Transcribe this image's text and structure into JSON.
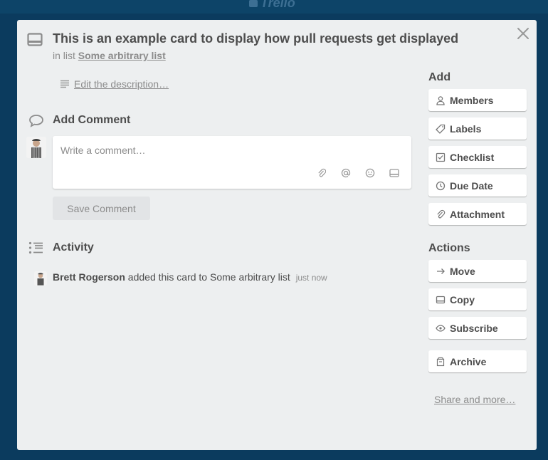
{
  "app": {
    "logo_text": "Trello"
  },
  "card": {
    "title": "This is an example card to display how pull requests get displayed",
    "in_list_prefix": "in list",
    "list_name": "Some arbitrary list",
    "edit_description": "Edit the description…"
  },
  "comment": {
    "heading": "Add Comment",
    "placeholder": "Write a comment…",
    "save_label": "Save Comment",
    "tool_icons": [
      "attachment-icon",
      "mention-icon",
      "emoji-icon",
      "card-icon"
    ]
  },
  "activity": {
    "heading": "Activity",
    "entries": [
      {
        "user": "Brett Rogerson",
        "action": "added this card to Some arbitrary list",
        "time": "just now"
      }
    ]
  },
  "sidebar": {
    "add_heading": "Add",
    "add_buttons": [
      {
        "label": "Members",
        "icon": "person-icon"
      },
      {
        "label": "Labels",
        "icon": "tag-icon"
      },
      {
        "label": "Checklist",
        "icon": "checkbox-icon"
      },
      {
        "label": "Due Date",
        "icon": "clock-icon"
      },
      {
        "label": "Attachment",
        "icon": "paperclip-icon"
      }
    ],
    "actions_heading": "Actions",
    "action_buttons": [
      {
        "label": "Move",
        "icon": "arrow-right-icon"
      },
      {
        "label": "Copy",
        "icon": "card-icon"
      },
      {
        "label": "Subscribe",
        "icon": "eye-icon"
      },
      {
        "label": "Archive",
        "icon": "archive-icon"
      }
    ],
    "share_label": "Share and more…"
  },
  "colors": {
    "backdrop": "#0b3b5e",
    "modal_bg": "#edeff0",
    "text_dark": "#4d4d4d",
    "text_muted": "#8c8c8c"
  }
}
